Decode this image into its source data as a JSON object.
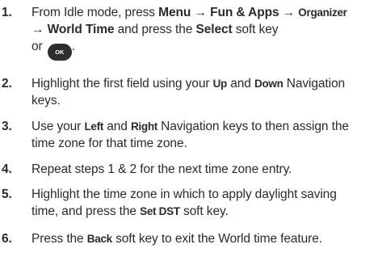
{
  "steps": [
    {
      "number": "1.",
      "line1_pre": "From Idle mode, press ",
      "menu": "Menu",
      "arrow1": " → ",
      "fun": "Fun & Apps",
      "arrow2": " → ",
      "organizer": "Organizer",
      "arrow3": "→ ",
      "world": "World Time",
      "mid": " and press the ",
      "select": "Select",
      "end": " soft key",
      "or": "or ",
      "ok_label": "OK",
      "period": "."
    },
    {
      "number": "2.",
      "pre": "Highlight the first field using your ",
      "up": "Up",
      "and": " and ",
      "down": "Down",
      "post1": " Navigation",
      "post2": "keys."
    },
    {
      "number": "3.",
      "pre": "Use your ",
      "left": "Left",
      "and": " and ",
      "right": "Right",
      "post1": " Navigation keys to then assign the",
      "post2": "time zone for that time zone."
    },
    {
      "number": "4.",
      "text": "Repeat steps 1 & 2 for the next time zone entry."
    },
    {
      "number": "5.",
      "line1": "Highlight the time zone in which to apply daylight saving",
      "pre": "time, and press the ",
      "setdst": "Set DST",
      "post": " soft key."
    },
    {
      "number": "6.",
      "pre": "Press the ",
      "back": "Back",
      "post": " soft key to exit the World time feature."
    }
  ]
}
